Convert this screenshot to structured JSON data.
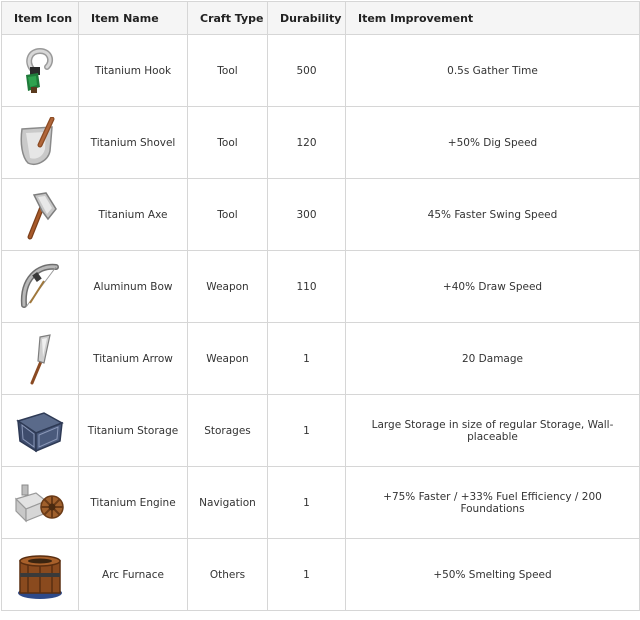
{
  "table": {
    "headers": [
      "Item Icon",
      "Item Name",
      "Craft Type",
      "Durability",
      "Item Improvement"
    ],
    "rows": [
      {
        "icon": "titanium-hook-icon",
        "name": "Titanium Hook",
        "craft_type": "Tool",
        "durability": "500",
        "improvement": "0.5s Gather Time"
      },
      {
        "icon": "titanium-shovel-icon",
        "name": "Titanium Shovel",
        "craft_type": "Tool",
        "durability": "120",
        "improvement": "+50% Dig Speed"
      },
      {
        "icon": "titanium-axe-icon",
        "name": "Titanium Axe",
        "craft_type": "Tool",
        "durability": "300",
        "improvement": "45% Faster Swing Speed"
      },
      {
        "icon": "aluminum-bow-icon",
        "name": "Aluminum Bow",
        "craft_type": "Weapon",
        "durability": "110",
        "improvement": "+40% Draw Speed"
      },
      {
        "icon": "titanium-arrow-icon",
        "name": "Titanium Arrow",
        "craft_type": "Weapon",
        "durability": "1",
        "improvement": "20 Damage"
      },
      {
        "icon": "titanium-storage-icon",
        "name": "Titanium Storage",
        "craft_type": "Storages",
        "durability": "1",
        "improvement": "Large Storage in size of regular Storage, Wall-placeable"
      },
      {
        "icon": "titanium-engine-icon",
        "name": "Titanium Engine",
        "craft_type": "Navigation",
        "durability": "1",
        "improvement": "+75% Faster / +33% Fuel Efficiency / 200 Foundations"
      },
      {
        "icon": "arc-furnace-icon",
        "name": "Arc Furnace",
        "craft_type": "Others",
        "durability": "1",
        "improvement": "+50% Smelting Speed"
      }
    ]
  }
}
